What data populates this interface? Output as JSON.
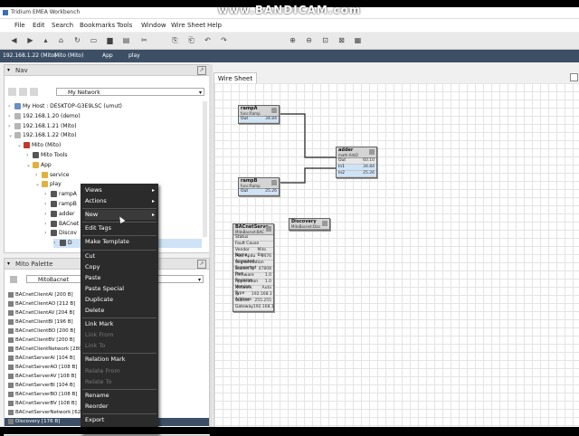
{
  "watermark": "www.BANDICAM.com",
  "window": {
    "title": "Tridium EMEA Workbench"
  },
  "menu": [
    "File",
    "Edit",
    "Search",
    "Bookmarks",
    "Tools",
    "Window",
    "Wire Sheet",
    "Help"
  ],
  "toolbar_icons": [
    "back-icon",
    "forward-icon",
    "up-icon",
    "home-icon",
    "refresh-icon",
    "new-tab-icon",
    "folder-icon",
    "save-icon",
    "cut-icon",
    "copy-icon",
    "paste-icon",
    "undo-icon",
    "redo-icon",
    "zoom-in-icon",
    "zoom-out-icon",
    "zoom-fit-icon",
    "zoom-reset-icon",
    "layout-icon"
  ],
  "path": [
    "192.168.1.22 (Mito)",
    "Mito (Mito)",
    "App",
    "play"
  ],
  "nav": {
    "title": "Nav",
    "selected": "My Network",
    "tree": [
      {
        "label": "My Host : DESKTOP-G3E9LSC (umut)",
        "indent": 0,
        "exp": "›",
        "color": "#6b8fc7"
      },
      {
        "label": "192.168.1.20 (demo)",
        "indent": 0,
        "exp": "›",
        "color": "#b5b5b5"
      },
      {
        "label": "192.168.1.21 (Mito)",
        "indent": 0,
        "exp": "›",
        "color": "#b5b5b5"
      },
      {
        "label": "192.168.1.22 (Mito)",
        "indent": 0,
        "exp": "⌄",
        "color": "#b5b5b5"
      },
      {
        "label": "Mito (Mito)",
        "indent": 1,
        "exp": "⌄",
        "color": "#c0392b"
      },
      {
        "label": "Mito Tools",
        "indent": 2,
        "exp": "›",
        "color": "#555"
      },
      {
        "label": "App",
        "indent": 2,
        "exp": "⌄",
        "color": "#e2b13c"
      },
      {
        "label": "service",
        "indent": 3,
        "exp": "›",
        "color": "#e2b13c"
      },
      {
        "label": "play",
        "indent": 3,
        "exp": "⌄",
        "color": "#e2b13c"
      },
      {
        "label": "rampA",
        "indent": 4,
        "exp": "›",
        "color": "#555"
      },
      {
        "label": "rampB",
        "indent": 4,
        "exp": "›",
        "color": "#555"
      },
      {
        "label": "adder",
        "indent": 4,
        "exp": "›",
        "color": "#555"
      },
      {
        "label": "BACnet",
        "indent": 4,
        "exp": "›",
        "color": "#555"
      },
      {
        "label": "Discov",
        "indent": 4,
        "exp": "›",
        "color": "#555"
      },
      {
        "label": "D",
        "indent": 5,
        "exp": "›",
        "color": "#555"
      }
    ]
  },
  "palette": {
    "title": "Mito Palette",
    "selected": "MitoBacnet",
    "items": [
      "BACnetClientAI [200 B]",
      "BACnetClientAO [212 B]",
      "BACnetClientAV [204 B]",
      "BACnetClientBI [196 B]",
      "BACnetClientBO [200 B]",
      "BACnetClientBV [200 B]",
      "BACnetClientNetwork [280 B]",
      "BACnetServerAI [104 B]",
      "BACnetServerAO [108 B]",
      "BACnetServerAV [108 B]",
      "BACnetServerBI [104 B]",
      "BACnetServerBO [108 B]",
      "BACnetServerBV [108 B]",
      "BACnetServerNetwork [624 B]",
      "Discovery [176 B]"
    ]
  },
  "context_menu": [
    {
      "label": "Views",
      "sub": true,
      "dis": false
    },
    {
      "label": "Actions",
      "sub": true,
      "dis": false
    },
    {
      "sep": true
    },
    {
      "label": "New",
      "sub": true,
      "dis": false,
      "active": true
    },
    {
      "sep": true
    },
    {
      "label": "Edit Tags",
      "dis": false
    },
    {
      "sep": true
    },
    {
      "label": "Make Template",
      "dis": false
    },
    {
      "sep": true
    },
    {
      "label": "Cut",
      "dis": false
    },
    {
      "label": "Copy",
      "dis": false
    },
    {
      "label": "Paste",
      "dis": false
    },
    {
      "label": "Paste Special",
      "dis": false
    },
    {
      "label": "Duplicate",
      "dis": false
    },
    {
      "label": "Delete",
      "dis": false
    },
    {
      "sep": true
    },
    {
      "label": "Link Mark",
      "dis": false
    },
    {
      "label": "Link From",
      "dis": true
    },
    {
      "label": "Link To",
      "dis": true
    },
    {
      "sep": true
    },
    {
      "label": "Relation Mark",
      "dis": false
    },
    {
      "label": "Relate From",
      "dis": true
    },
    {
      "label": "Relate To",
      "dis": true
    },
    {
      "sep": true
    },
    {
      "label": "Rename",
      "dis": false
    },
    {
      "label": "Reorder",
      "dis": false
    },
    {
      "sep": true
    },
    {
      "label": "Export",
      "dis": false
    }
  ],
  "wiresheet": {
    "tab": "Wire Sheet",
    "components": {
      "rampA": {
        "name": "rampA",
        "type": "func:Ramp",
        "rows": [
          [
            "Out",
            "34.84"
          ]
        ]
      },
      "rampB": {
        "name": "rampB",
        "type": "func:Ramp",
        "rows": [
          [
            "Out",
            "25.26"
          ]
        ]
      },
      "adder": {
        "name": "adder",
        "type": "math:Add2",
        "rows": [
          [
            "Out",
            "60.10"
          ],
          [
            "In1",
            "34.84"
          ],
          [
            "In2",
            "25.26"
          ]
        ]
      },
      "bacnet": {
        "name": "BACnetServe",
        "type": "MitoBacnet:BAC",
        "rows": [
          [
            "Status",
            ""
          ],
          [
            "Fault Cause",
            ""
          ],
          [
            "Vendor Name",
            "Mito Bac"
          ],
          [
            "Max Apdu Accepted",
            "1476"
          ],
          [
            "Segmentation Supported",
            ""
          ],
          [
            "Bacnet Ip Port",
            "47808"
          ],
          [
            "Firmware Revision",
            "1.0"
          ],
          [
            "Application Version",
            "1.0"
          ],
          [
            "Network Type",
            "Auto"
          ],
          [
            "Ip Address",
            "192.168.1"
          ],
          [
            "Subnet",
            "255.255"
          ],
          [
            "Gateway",
            "192.168.1"
          ]
        ]
      },
      "discovery": {
        "name": "Discovery",
        "type": "MitoBacnet:Disc"
      }
    }
  }
}
